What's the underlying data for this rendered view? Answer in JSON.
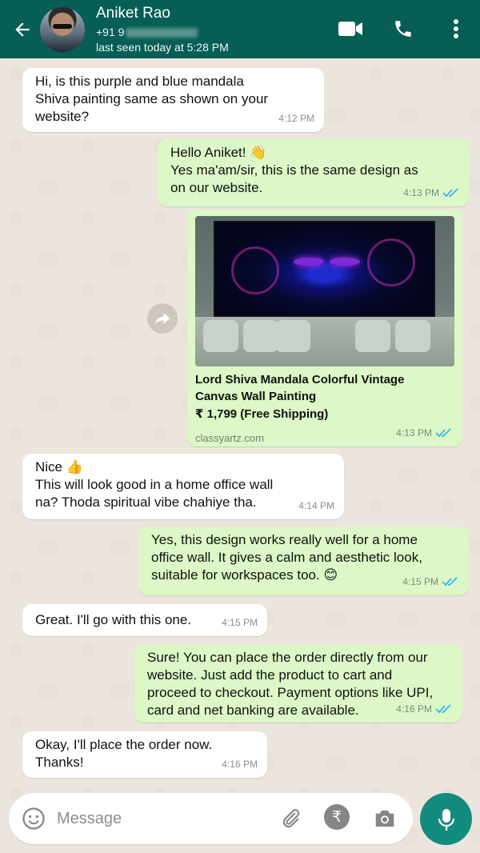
{
  "header": {
    "contact_name": "Aniket Rao",
    "phone_prefix": "+91 9",
    "last_seen": "last seen today at 5:28 PM",
    "icons": [
      "back-arrow-icon",
      "video-call-icon",
      "phone-icon",
      "more-vert-icon"
    ],
    "background_color": "#075e54"
  },
  "messages": [
    {
      "direction": "in",
      "text": "Hi, is this purple and blue mandala Shiva painting same as shown on your website?",
      "time": "4:12 PM"
    },
    {
      "direction": "out",
      "text_line1": "Hello Aniket! 👋",
      "text_line2": "Yes ma'am/sir, this is the same design as on our website.",
      "time": "4:13 PM",
      "read": true
    },
    {
      "direction": "out",
      "type": "link_preview",
      "title": "Lord Shiva Mandala Colorful Vintage Canvas Wall Painting",
      "price": "₹ 1,799 (Free Shipping)",
      "domain": "classyartz.com",
      "time": "4:13 PM",
      "read": true
    },
    {
      "direction": "in",
      "text_line1": "Nice 👍",
      "text_line2": "This will look good in a home office wall na? Thoda spiritual vibe chahiye tha.",
      "time": "4:14 PM"
    },
    {
      "direction": "out",
      "text": "Yes, this design works really well for a home office wall. It gives a calm and aesthetic look, suitable for workspaces too. 😊",
      "time": "4:15 PM",
      "read": true
    },
    {
      "direction": "in",
      "text": "Great. I'll go with this one.",
      "time": "4:15 PM"
    },
    {
      "direction": "out",
      "text": "Sure! You can place the order directly from our website. Just add the product to cart and proceed to checkout. Payment options like UPI, card and net banking are available.",
      "time": "4:16 PM",
      "read": true
    },
    {
      "direction": "in",
      "text": "Okay, I'll place the order now. Thanks!",
      "time": "4:16 PM"
    }
  ],
  "composer": {
    "placeholder": "Message",
    "icons": [
      "emoji-icon",
      "attach-icon",
      "rupee-icon",
      "camera-icon",
      "mic-icon"
    ],
    "rupee_symbol": "₹"
  },
  "colors": {
    "outgoing_bubble": "#dcf8c6",
    "incoming_bubble": "#ffffff",
    "read_tick": "#34b7f1",
    "accent": "#128c7e"
  }
}
